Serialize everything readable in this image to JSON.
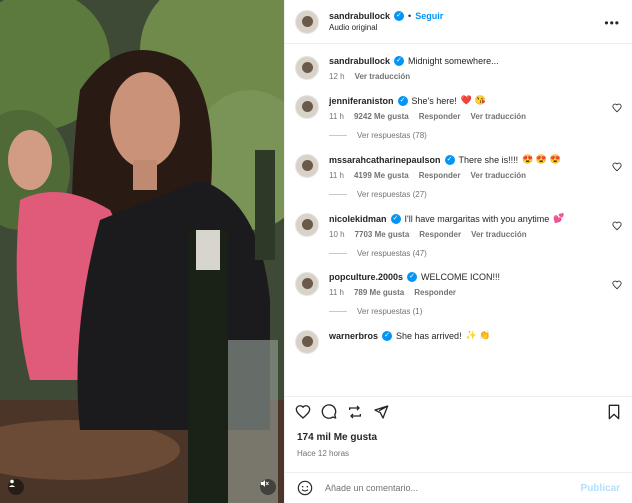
{
  "header": {
    "username": "sandrabullock",
    "separator": "•",
    "follow": "Seguir",
    "subtitle": "Audio original",
    "more_icon": "more-horizontal-icon"
  },
  "caption": {
    "username": "sandrabullock",
    "text": "Midnight somewhere...",
    "time": "12 h",
    "translate": "Ver traducción"
  },
  "comments": [
    {
      "username": "jenniferaniston",
      "text": "She's here!",
      "emoji": "❤️ 😘",
      "time": "11 h",
      "likes": "9242 Me gusta",
      "reply": "Responder",
      "translate": "Ver traducción",
      "replies": "Ver respuestas (78)"
    },
    {
      "username": "mssarahcatharinepaulson",
      "text": "There she is!!!!",
      "emoji": "😍 😍 😍",
      "time": "11 h",
      "likes": "4199 Me gusta",
      "reply": "Responder",
      "translate": "Ver traducción",
      "replies": "Ver respuestas (27)"
    },
    {
      "username": "nicolekidman",
      "text": "I'll have margaritas with you anytime",
      "emoji": "💕",
      "time": "10 h",
      "likes": "7703 Me gusta",
      "reply": "Responder",
      "translate": "Ver traducción",
      "replies": "Ver respuestas (47)"
    },
    {
      "username": "popculture.2000s",
      "text": "WELCOME ICON!!!",
      "emoji": "",
      "time": "11 h",
      "likes": "789 Me gusta",
      "reply": "Responder",
      "translate": "",
      "replies": "Ver respuestas (1)"
    },
    {
      "username": "warnerbros",
      "text": "She has arrived!",
      "emoji": "✨ 👏",
      "time": "",
      "likes": "",
      "reply": "",
      "translate": "",
      "replies": ""
    }
  ],
  "actions": {
    "like_icon": "heart-icon",
    "comment_icon": "comment-icon",
    "repost_icon": "repost-icon",
    "share_icon": "share-icon",
    "save_icon": "bookmark-icon"
  },
  "likes": "174 mil Me gusta",
  "posted": "Hace 12 horas",
  "composer": {
    "placeholder": "Añade un comentario...",
    "post": "Publicar",
    "emoji_icon": "smiley-icon"
  },
  "colors": {
    "accent": "#0095f6",
    "muted": "#737373",
    "post_disabled": "#b2dffc"
  }
}
